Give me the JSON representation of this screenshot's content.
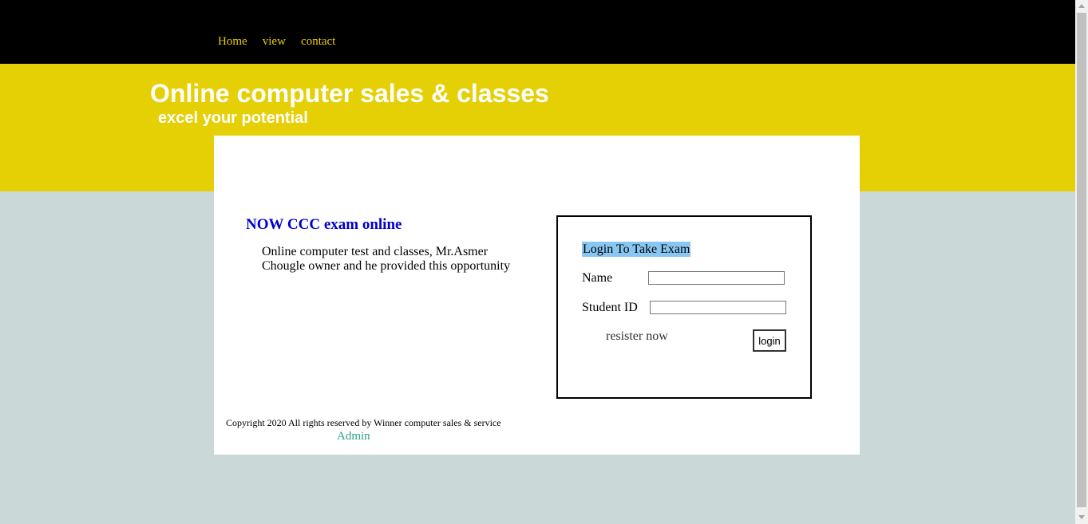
{
  "nav": {
    "items": [
      "Home",
      "view",
      "contact"
    ]
  },
  "hero": {
    "title": "Online computer sales & classes",
    "tagline": "excel your potential"
  },
  "news": {
    "heading": "NOW CCC exam online",
    "body": "Online computer test and classes, Mr.Asmer Chougle owner and he provided this opportunity"
  },
  "login": {
    "title": "Login To Take Exam",
    "name_label": "Name",
    "name_value": "",
    "student_id_label": "Student ID",
    "student_id_value": "",
    "register_label": "resister now",
    "button_label": "login"
  },
  "footer": {
    "copyright": "Copyright 2020 All rights reserved by Winner computer sales & service",
    "admin_label": "Admin"
  },
  "colors": {
    "topbar": "#000000",
    "accent_yellow": "#e5d005",
    "page_bg": "#cad9d8",
    "heading_blue": "#0000cd",
    "title_highlight": "#87c7f2",
    "admin_link": "#2a9d8f"
  }
}
